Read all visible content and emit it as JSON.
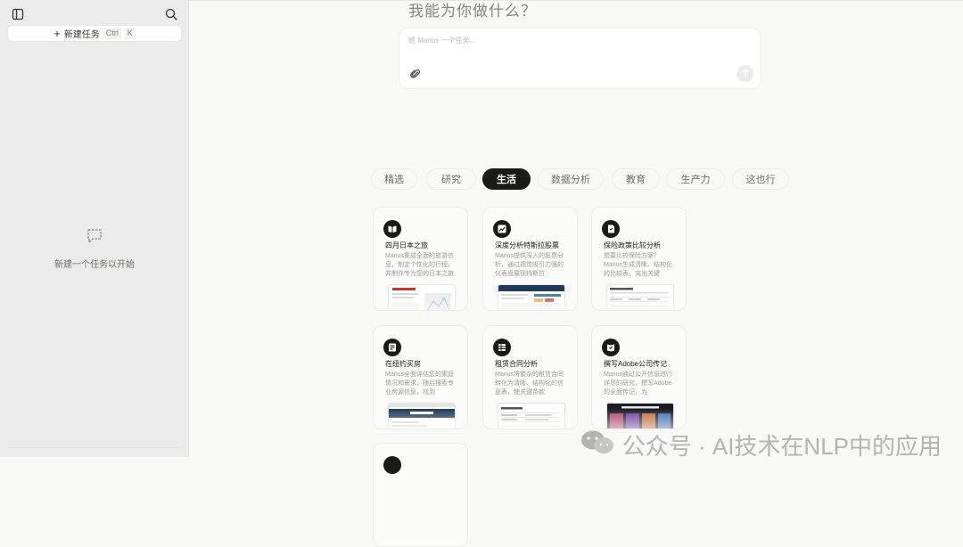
{
  "sidebar": {
    "new_task_label": "新建任务",
    "shortcut_ctrl": "Ctrl",
    "shortcut_key": "K",
    "empty_text": "新建一个任务以开始"
  },
  "main": {
    "greeting": "我能为你做什么？",
    "input_placeholder": "给 Manus 一个任务..."
  },
  "tabs": [
    {
      "label": "精选",
      "active": false
    },
    {
      "label": "研究",
      "active": false
    },
    {
      "label": "生活",
      "active": true
    },
    {
      "label": "数据分析",
      "active": false
    },
    {
      "label": "教育",
      "active": false
    },
    {
      "label": "生产力",
      "active": false
    },
    {
      "label": "这也行",
      "active": false
    }
  ],
  "cards": [
    {
      "title": "四月日本之旅",
      "desc": "Manus集成全面的旅游信息，制定个性化的行程，并制作专为您的日本之旅"
    },
    {
      "title": "深度分析特斯拉股票",
      "desc": "Manus提供深入的股票分析，通过视觉吸引力强的仪表盘展现特斯拉"
    },
    {
      "title": "保险政策比较分析",
      "desc": "想要比较保险方案？Manus生成清晰、结构化的比较表，突出关键"
    },
    {
      "title": "在纽约买房",
      "desc": "Manus全面评估您的家庭情况和需求，随后搜索专业房源信息，找到"
    },
    {
      "title": "租赁合同分析",
      "desc": "Manus将繁杂的租赁合同转化为清晰、结构化的信息表，使关键条款"
    },
    {
      "title": "撰写Adobe公司传记",
      "desc": "Manus通过公开信息进行详尽的研究，撰写Adobe的全面传记，为"
    }
  ],
  "icons": {
    "sidebar_toggle": "sidebar-toggle-icon",
    "search": "search-icon",
    "empty": "chat-bubble-icon",
    "attach": "paperclip-icon",
    "send": "arrow-up-icon"
  },
  "watermark": {
    "text": "公众号 · AI技术在NLP中的应用"
  },
  "colors": {
    "accent": "#1a1a19",
    "background": "#f8f8f7",
    "sidebar": "#ebebeb"
  }
}
